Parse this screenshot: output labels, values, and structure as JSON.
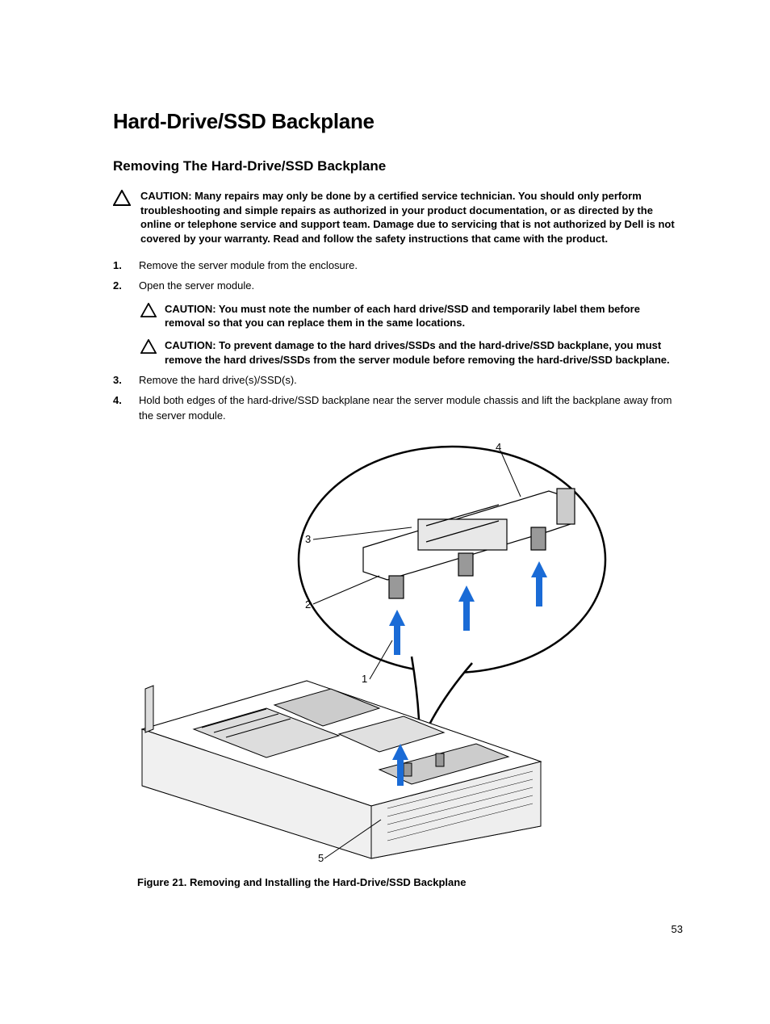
{
  "heading1": "Hard-Drive/SSD Backplane",
  "heading2": "Removing The Hard-Drive/SSD Backplane",
  "caution_main": "CAUTION: Many repairs may only be done by a certified service technician. You should only perform troubleshooting and simple repairs as authorized in your product documentation, or as directed by the online or telephone service and support team. Damage due to servicing that is not authorized by Dell is not covered by your warranty. Read and follow the safety instructions that came with the product.",
  "steps": {
    "s1": "Remove the server module from the enclosure.",
    "s2": "Open the server module.",
    "s2_caution_a": "CAUTION: You must note the number of each hard drive/SSD and temporarily label them before removal so that you can replace them in the same locations.",
    "s2_caution_b": "CAUTION: To prevent damage to the hard drives/SSDs and the hard-drive/SSD backplane, you must remove the hard drives/SSDs from the server module before removing the hard-drive/SSD backplane.",
    "s3": "Remove the hard drive(s)/SSD(s).",
    "s4": "Hold both edges of the hard-drive/SSD backplane near the server module chassis and lift the backplane away from the server module."
  },
  "figure_caption": "Figure 21. Removing and Installing the Hard-Drive/SSD Backplane",
  "callouts": {
    "c1": "1",
    "c2": "2",
    "c3": "3",
    "c4": "4",
    "c5": "5"
  },
  "page_number": "53"
}
